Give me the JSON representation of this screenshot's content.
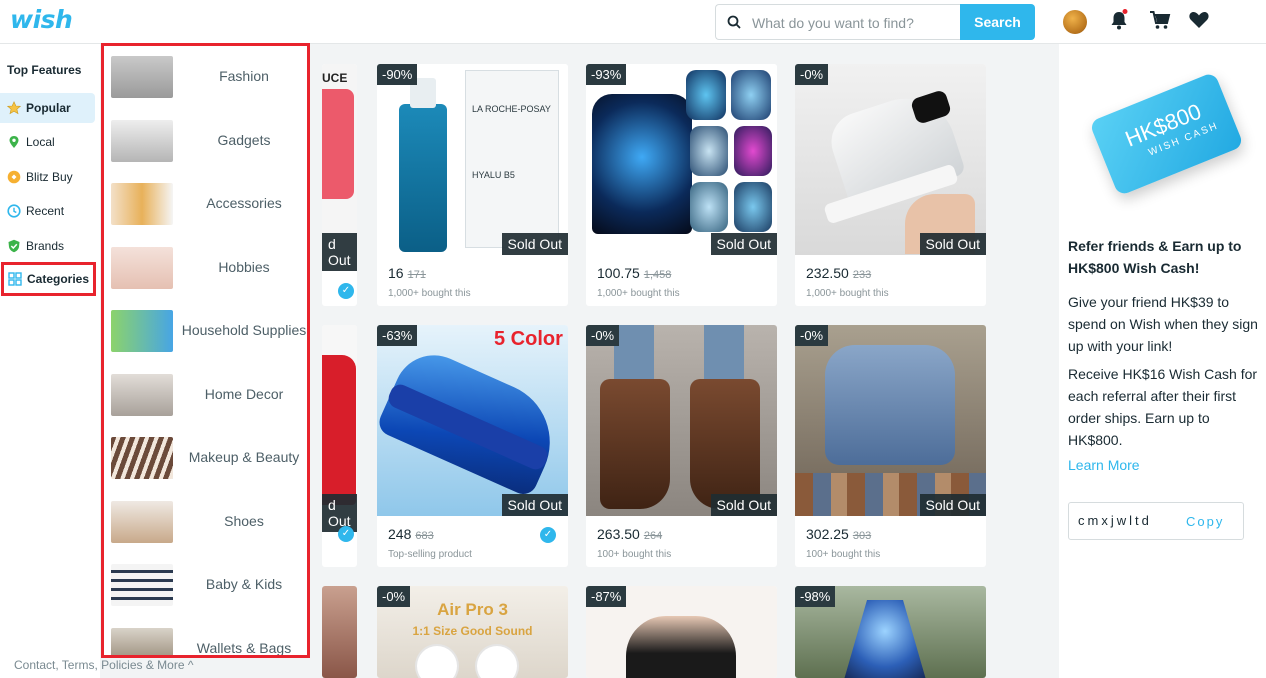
{
  "header": {
    "logo": "wish",
    "search_placeholder": "What do you want to find?",
    "search_button": "Search"
  },
  "leftnav": {
    "title": "Top Features",
    "items": [
      {
        "label": "Popular",
        "icon": "star-icon"
      },
      {
        "label": "Local",
        "icon": "location-pin-icon"
      },
      {
        "label": "Blitz Buy",
        "icon": "blitz-icon"
      },
      {
        "label": "Recent",
        "icon": "clock-icon"
      },
      {
        "label": "Brands",
        "icon": "shield-check-icon"
      },
      {
        "label": "Categories",
        "icon": "grid-icon"
      }
    ]
  },
  "categories": [
    "Fashion",
    "Gadgets",
    "Accessories",
    "Hobbies",
    "Household Supplies",
    "Home Decor",
    "Makeup & Beauty",
    "Shoes",
    "Baby & Kids",
    "Wallets & Bags"
  ],
  "products": [
    {
      "badge": "-90%",
      "price": "16",
      "old": "171",
      "sub": "1,000+ bought this",
      "sold_out": "Sold Out"
    },
    {
      "badge": "-93%",
      "price": "100.75",
      "old": "1,458",
      "sub": "1,000+ bought this",
      "sold_out": "Sold Out"
    },
    {
      "badge": "-0%",
      "price": "232.50",
      "old": "233",
      "sub": "1,000+ bought this",
      "sold_out": "Sold Out"
    },
    {
      "badge": "-63%",
      "price": "248",
      "old": "683",
      "sub": "Top-selling product",
      "sold_out": "Sold Out",
      "overlay": "5 Color"
    },
    {
      "badge": "-0%",
      "price": "263.50",
      "old": "264",
      "sub": "100+ bought this",
      "sold_out": "Sold Out"
    },
    {
      "badge": "-0%",
      "price": "302.25",
      "old": "303",
      "sub": "100+ bought this",
      "sold_out": "Sold Out"
    },
    {
      "badge": "-0%",
      "overlay": "Air Pro 3",
      "overlay2": "1:1 Size  Good Sound"
    },
    {
      "badge": "-87%"
    },
    {
      "badge": "-98%"
    }
  ],
  "partial_cards": {
    "sold_out": "d Out",
    "top_fragment": "UCE"
  },
  "referral": {
    "card_amount": "HK$800",
    "card_sub": "WISH CASH",
    "title": "Refer friends & Earn up to HK$800 Wish Cash!",
    "p1": "Give your friend HK$39 to spend on Wish when they sign up with your link!",
    "p2": "Receive HK$16 Wish Cash for each referral after their first order ships. Earn up to HK$800.",
    "learn_more": "Learn More",
    "code": "cmxjwltd",
    "copy": "Copy"
  },
  "footer": {
    "link": "Contact, Terms, Policies & More ^"
  }
}
